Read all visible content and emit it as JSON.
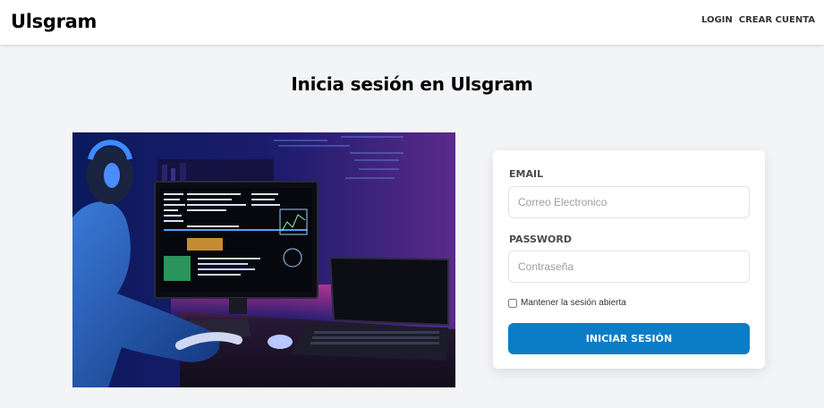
{
  "header": {
    "brand": "Ulsgram",
    "nav": {
      "login": "LOGIN",
      "register": "CREAR CUENTA"
    }
  },
  "main": {
    "title": "Inicia sesión en Ulsgram"
  },
  "form": {
    "email_label": "EMAIL",
    "email_placeholder": "Correo Electronico",
    "password_label": "PASSWORD",
    "password_placeholder": "Contraseña",
    "remember_label": "Mantener la sesión abierta",
    "submit_label": "INICIAR SESIÓN"
  },
  "colors": {
    "accent": "#0b7dc6",
    "page_background": "#f3f4f6"
  }
}
